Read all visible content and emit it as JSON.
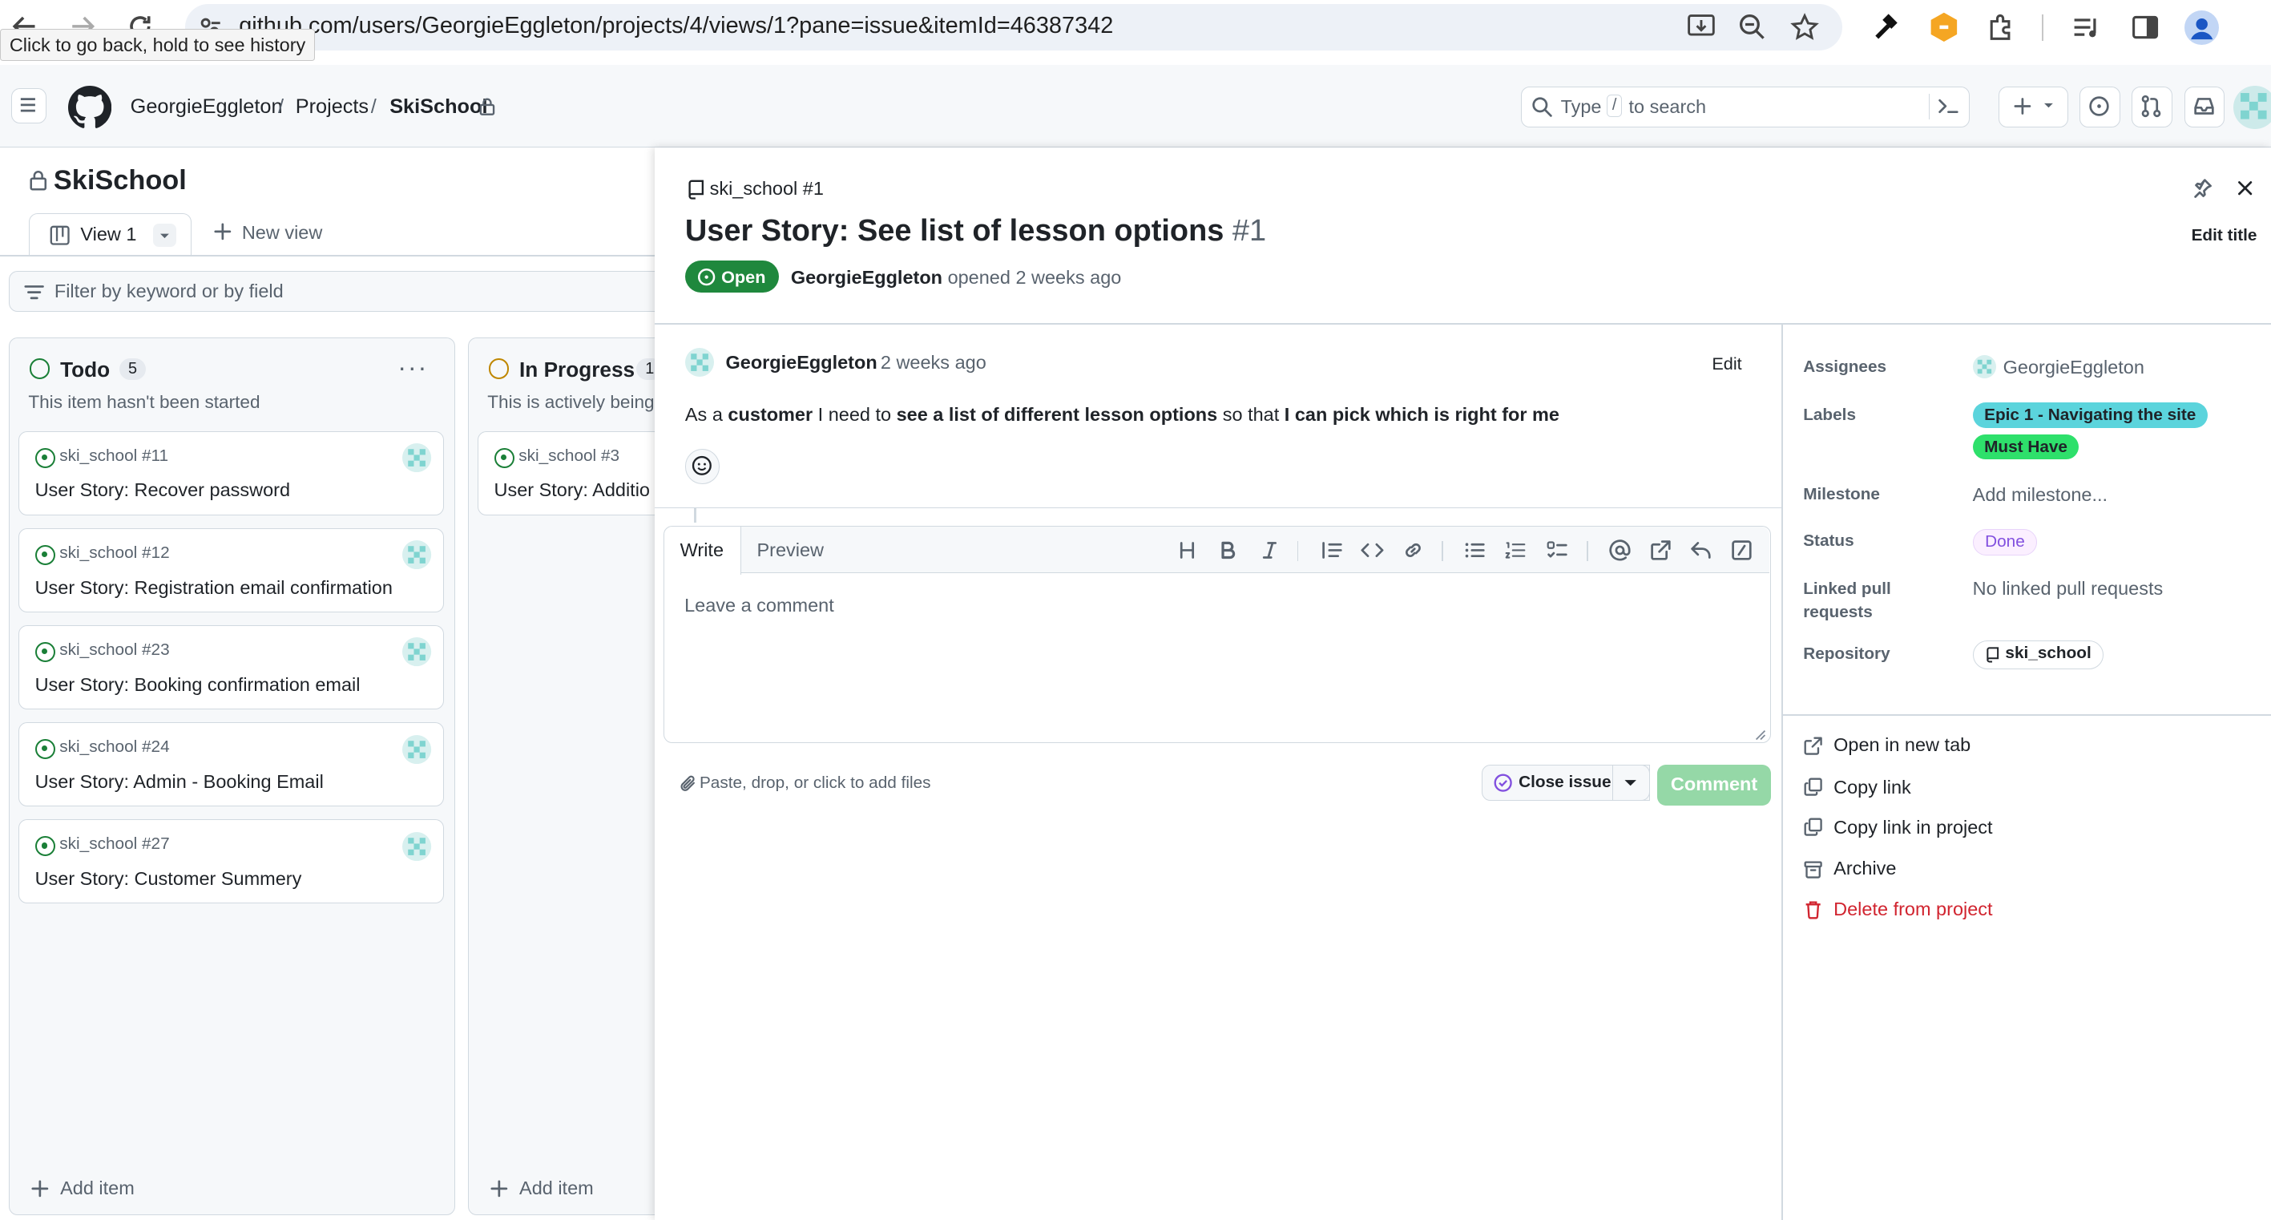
{
  "browser": {
    "url": "github.com/users/GeorgieEggleton/projects/4/views/1?pane=issue&itemId=46387342",
    "back_tooltip": "Click to go back, hold to see history"
  },
  "header": {
    "breadcrumb_user": "GeorgieEggleton",
    "breadcrumb_sep1": "/",
    "breadcrumb_projects": "Projects",
    "breadcrumb_sep2": "/",
    "breadcrumb_project": "SkiSchool",
    "search_prefix": "Type",
    "search_key": "/",
    "search_suffix": "to search"
  },
  "project": {
    "title": "SkiSchool",
    "view_tab": "View 1",
    "new_view": "New view",
    "filter_placeholder": "Filter by keyword or by field"
  },
  "columns": [
    {
      "name": "Todo",
      "count": "5",
      "description": "This item hasn't been started",
      "add_item": "Add item",
      "cards": [
        {
          "number": "ski_school #11",
          "title": "User Story: Recover password"
        },
        {
          "number": "ski_school #12",
          "title": "User Story: Registration email confirmation"
        },
        {
          "number": "ski_school #23",
          "title": "User Story: Booking confirmation email"
        },
        {
          "number": "ski_school #24",
          "title": "User Story: Admin - Booking Email"
        },
        {
          "number": "ski_school #27",
          "title": "User Story: Customer Summery"
        }
      ]
    },
    {
      "name": "In Progress",
      "count": "1",
      "description": "This is actively being",
      "add_item": "Add item",
      "cards": [
        {
          "number": "ski_school #3",
          "title": "User Story: Additio"
        }
      ]
    }
  ],
  "issue": {
    "repo_ref": "ski_school #1",
    "title": "User Story: See list of lesson options",
    "number": "#1",
    "edit_title": "Edit title",
    "state": "Open",
    "author": "GeorgieEggleton",
    "opened_text": "opened 2 weeks ago",
    "comment_author": "GeorgieEggleton",
    "comment_time": "2 weeks ago",
    "edit_label": "Edit",
    "body": {
      "p1": "As a ",
      "b1": "customer",
      "p2": " I need to ",
      "b2": "see a list of different lesson options",
      "p3": " so that ",
      "b3": "I can pick which is right for me"
    }
  },
  "composer": {
    "tab_write": "Write",
    "tab_preview": "Preview",
    "placeholder": "Leave a comment",
    "attach_hint": "Paste, drop, or click to add files",
    "close_issue": "Close issue",
    "comment_button": "Comment"
  },
  "sidebar": {
    "assignees_label": "Assignees",
    "assignee": "GeorgieEggleton",
    "labels_label": "Labels",
    "label1": "Epic 1 - Navigating the site",
    "label2": "Must Have",
    "milestone_label": "Milestone",
    "milestone_value": "Add milestone...",
    "status_label": "Status",
    "status_value": "Done",
    "linked_label_1": "Linked pull",
    "linked_label_2": "requests",
    "linked_value": "No linked pull requests",
    "repository_label": "Repository",
    "repository_value": "ski_school",
    "actions": {
      "open_new_tab": "Open in new tab",
      "copy_link": "Copy link",
      "copy_link_project": "Copy link in project",
      "archive": "Archive",
      "delete": "Delete from project"
    }
  },
  "colors": {
    "open_green": "#1f883d",
    "label_epic": "#5bd4dc",
    "label_must": "#2ee06b",
    "status_done_bg": "#fbefff",
    "status_done_fg": "#8250df",
    "delete_red": "#d1242f",
    "comment_btn": "#95d8a7"
  }
}
